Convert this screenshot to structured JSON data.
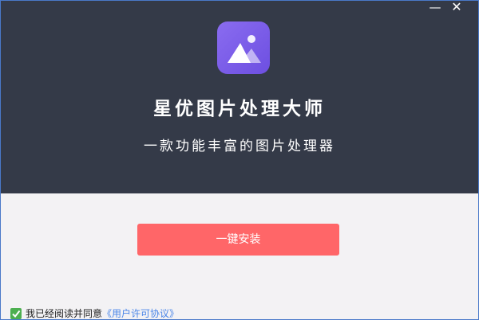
{
  "window": {
    "minimize_label": "—",
    "close_label": "✕"
  },
  "header": {
    "title": "星优图片处理大师",
    "subtitle": "一款功能丰富的图片处理器",
    "logo_icon": "mountain-sun-icon"
  },
  "main": {
    "install_label": "一键安装"
  },
  "agreement": {
    "checked": true,
    "text": "我已经阅读并同意",
    "link_text": "《用户许可协议》"
  },
  "colors": {
    "header_bg": "#343a48",
    "body_bg": "#f3f2f4",
    "install_button": "#ff6668",
    "logo_gradient_start": "#8a6cf0",
    "logo_gradient_end": "#6d4fe1",
    "checkbox": "#4caf50",
    "link": "#4a86e8"
  }
}
